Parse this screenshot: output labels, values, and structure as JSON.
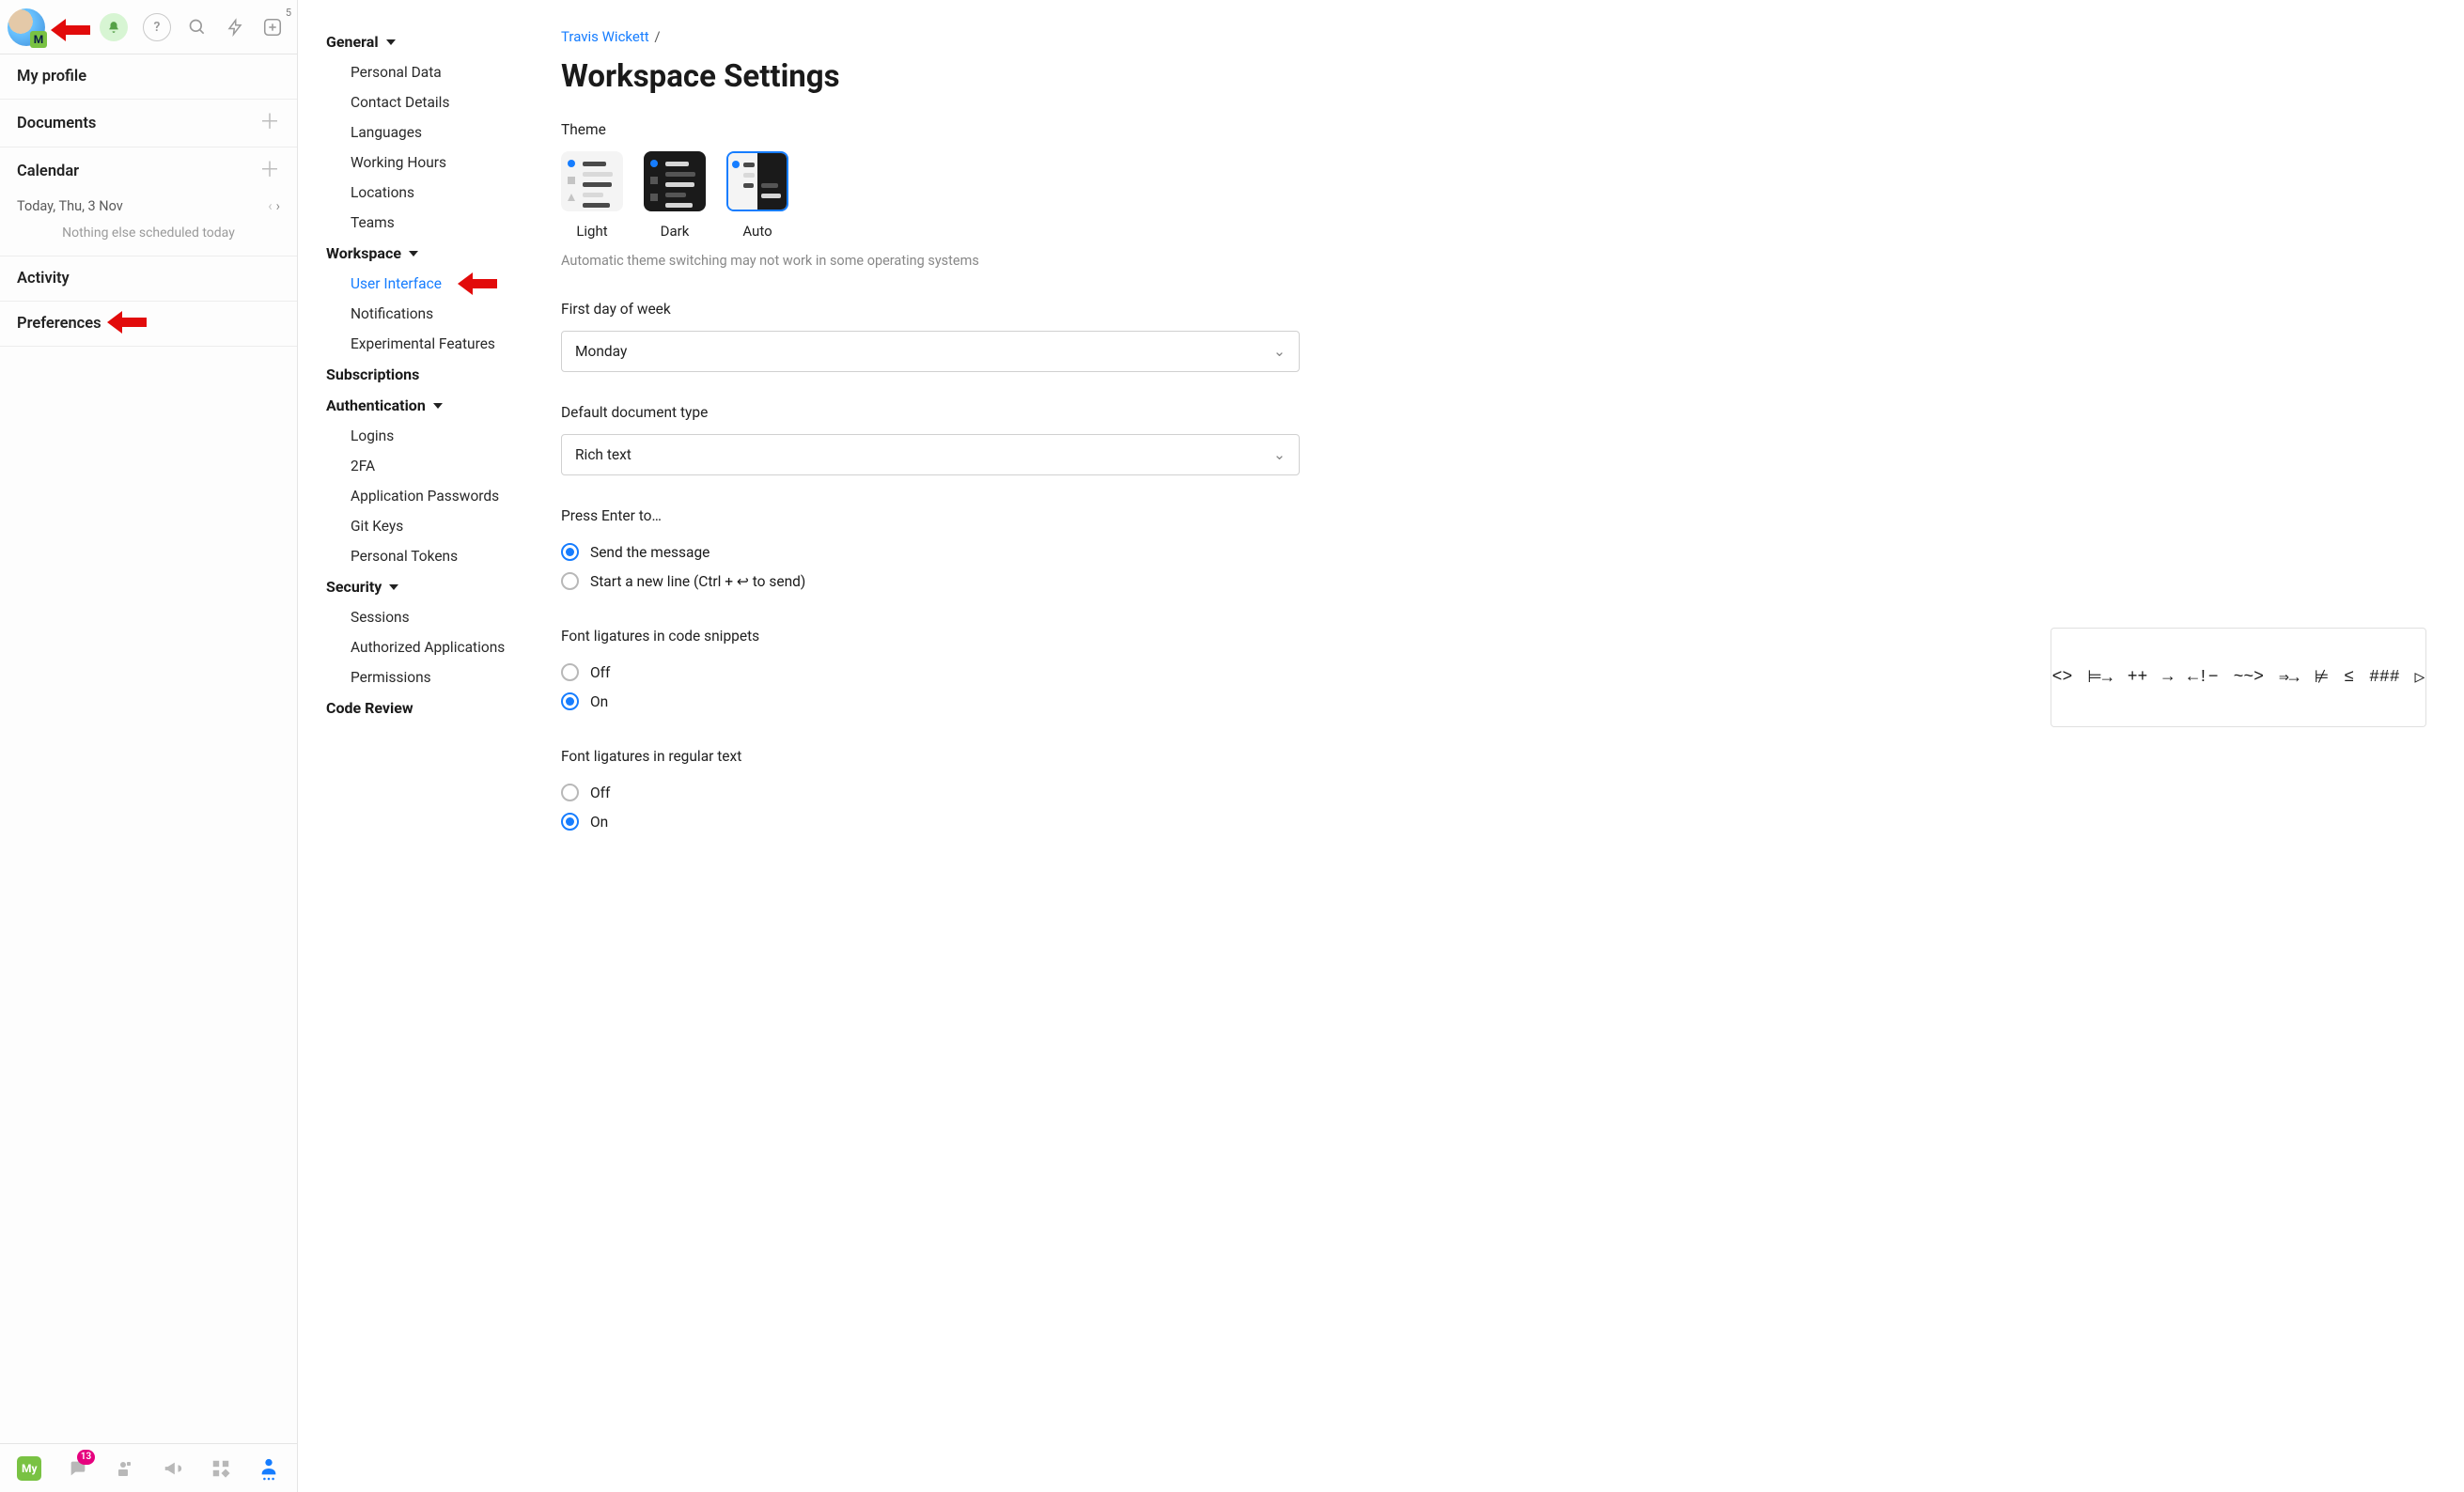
{
  "topbar": {
    "avatar_badge_letter": "M",
    "plus_superscript": "5"
  },
  "left": {
    "my_profile": "My profile",
    "documents": "Documents",
    "calendar": "Calendar",
    "calendar_today": "Today, Thu, 3 Nov",
    "calendar_empty": "Nothing else scheduled today",
    "activity": "Activity",
    "preferences": "Preferences"
  },
  "bottom": {
    "my_chip": "My",
    "chat_badge": "13"
  },
  "nav": {
    "general": "General",
    "general_items": [
      "Personal Data",
      "Contact Details",
      "Languages",
      "Working Hours",
      "Locations",
      "Teams"
    ],
    "workspace": "Workspace",
    "workspace_items": [
      "User Interface",
      "Notifications",
      "Experimental Features"
    ],
    "subscriptions": "Subscriptions",
    "authentication": "Authentication",
    "authentication_items": [
      "Logins",
      "2FA",
      "Application Passwords",
      "Git Keys",
      "Personal Tokens"
    ],
    "security": "Security",
    "security_items": [
      "Sessions",
      "Authorized Applications",
      "Permissions"
    ],
    "code_review": "Code Review"
  },
  "main": {
    "breadcrumb_user": "Travis Wickett",
    "breadcrumb_sep": "/",
    "title": "Workspace Settings",
    "theme": {
      "label": "Theme",
      "light": "Light",
      "dark": "Dark",
      "auto": "Auto",
      "hint": "Automatic theme switching may not work in some operating systems"
    },
    "first_day": {
      "label": "First day of week",
      "value": "Monday"
    },
    "doc_type": {
      "label": "Default document type",
      "value": "Rich text"
    },
    "press_enter": {
      "label": "Press Enter to…",
      "opt_send": "Send the message",
      "opt_newline": "Start a new line (Ctrl + ↩ to send)"
    },
    "lig_code": {
      "label": "Font ligatures in code snippets",
      "off": "Off",
      "on": "On"
    },
    "lig_text": {
      "label": "Font ligatures in regular text",
      "off": "Off",
      "on": "On"
    },
    "lig_samples": [
      "<>",
      "⊨→",
      "++",
      "→",
      "←!−",
      "~~>",
      "⇒→",
      "⊭",
      "≤",
      "###",
      "▷"
    ]
  }
}
